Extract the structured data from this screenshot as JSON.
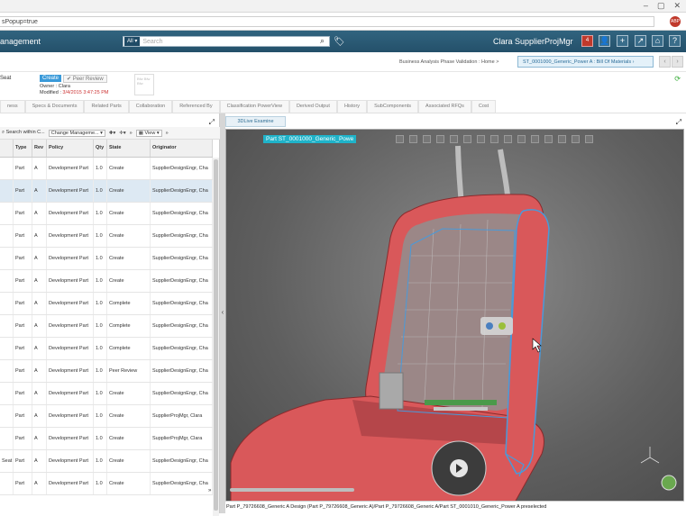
{
  "browser": {
    "url": "sPopup=true",
    "window_controls": [
      "–",
      "▢",
      "✕"
    ]
  },
  "header": {
    "app_title": "anagement",
    "search_scope": "All ▾",
    "search_placeholder": "Search",
    "user_name": "Clara SupplierProjMgr",
    "notification_count": "4"
  },
  "subheader": {
    "breadcrumb": "Business Analysis Phase Validation : Home  >",
    "context_label": "ST_0001000_Generic_Power A : Bill Of Materials"
  },
  "object": {
    "name": "Seat",
    "state_current": "Create",
    "state_next": "Peer Review",
    "owner": "Owner : Clara",
    "modified_label": "Modified :",
    "modified_value": "3/4/2015 3:47:25 PM",
    "thumbnail_text": "Bfw Bfw Bfw"
  },
  "tabs": [
    "ness",
    "Specs & Documents",
    "Related Parts",
    "Collaboration",
    "Referenced By",
    "Classification PowerView",
    "Derived Output",
    "History",
    "SubComponents",
    "Associated RFQs",
    "Cost"
  ],
  "table": {
    "toolbar": {
      "search_text": "Search within C...",
      "change_mgmt": "Change Manageme...",
      "view": "View"
    },
    "columns": [
      "",
      "Type",
      "Rev",
      "Policy",
      "Qty",
      "State",
      "Originator"
    ],
    "rows": [
      [
        "",
        "Part",
        "A",
        "Development Part",
        "1.0",
        "Create",
        "SupplierDesignEngr, Cha"
      ],
      [
        "",
        "Part",
        "A",
        "Development Part",
        "1.0",
        "Create",
        "SupplierDesignEngr, Cha"
      ],
      [
        "",
        "Part",
        "A",
        "Development Part",
        "1.0",
        "Create",
        "SupplierDesignEngr, Cha"
      ],
      [
        "",
        "Part",
        "A",
        "Development Part",
        "1.0",
        "Create",
        "SupplierDesignEngr, Cha"
      ],
      [
        "",
        "Part",
        "A",
        "Development Part",
        "1.0",
        "Create",
        "SupplierDesignEngr, Cha"
      ],
      [
        "",
        "Part",
        "A",
        "Development Part",
        "1.0",
        "Create",
        "SupplierDesignEngr, Cha"
      ],
      [
        "",
        "Part",
        "A",
        "Development Part",
        "1.0",
        "Complete",
        "SupplierDesignEngr, Cha"
      ],
      [
        "",
        "Part",
        "A",
        "Development Part",
        "1.0",
        "Complete",
        "SupplierDesignEngr, Cha"
      ],
      [
        "",
        "Part",
        "A",
        "Development Part",
        "1.0",
        "Complete",
        "SupplierDesignEngr, Cha"
      ],
      [
        "",
        "Part",
        "A",
        "Development Part",
        "1.0",
        "Peer Review",
        "SupplierDesignEngr, Cha"
      ],
      [
        "",
        "Part",
        "A",
        "Development Part",
        "1.0",
        "Create",
        "SupplierDesignEngr, Cha"
      ],
      [
        "",
        "Part",
        "A",
        "Development Part",
        "1.0",
        "Create",
        "SupplierProjMgr, Clara"
      ],
      [
        "",
        "Part",
        "A",
        "Development Part",
        "1.0",
        "Create",
        "SupplierProjMgr, Clara"
      ],
      [
        "Seat",
        "Part",
        "A",
        "Development Part",
        "1.0",
        "Create",
        "SupplierDesignEngr, Cha"
      ],
      [
        "",
        "Part",
        "A",
        "Development Part",
        "1.0",
        "Create",
        "SupplierDesignEngr, Cha"
      ]
    ]
  },
  "viewer": {
    "tab_label": "3DLive Examine",
    "part_label": "Part ST_0001000_Generic_Powe",
    "status": "Part P_79726608_Generic A Design (Part P_79726608_Generic A)/Part P_79726608_Generic A/Part ST_0001010_Generic_Power A preselected"
  },
  "colors": {
    "header_bg": "#2b5876",
    "accent": "#1fb3c9",
    "seat_red": "#d9585a",
    "highlight_blue": "#4a9ad9"
  }
}
